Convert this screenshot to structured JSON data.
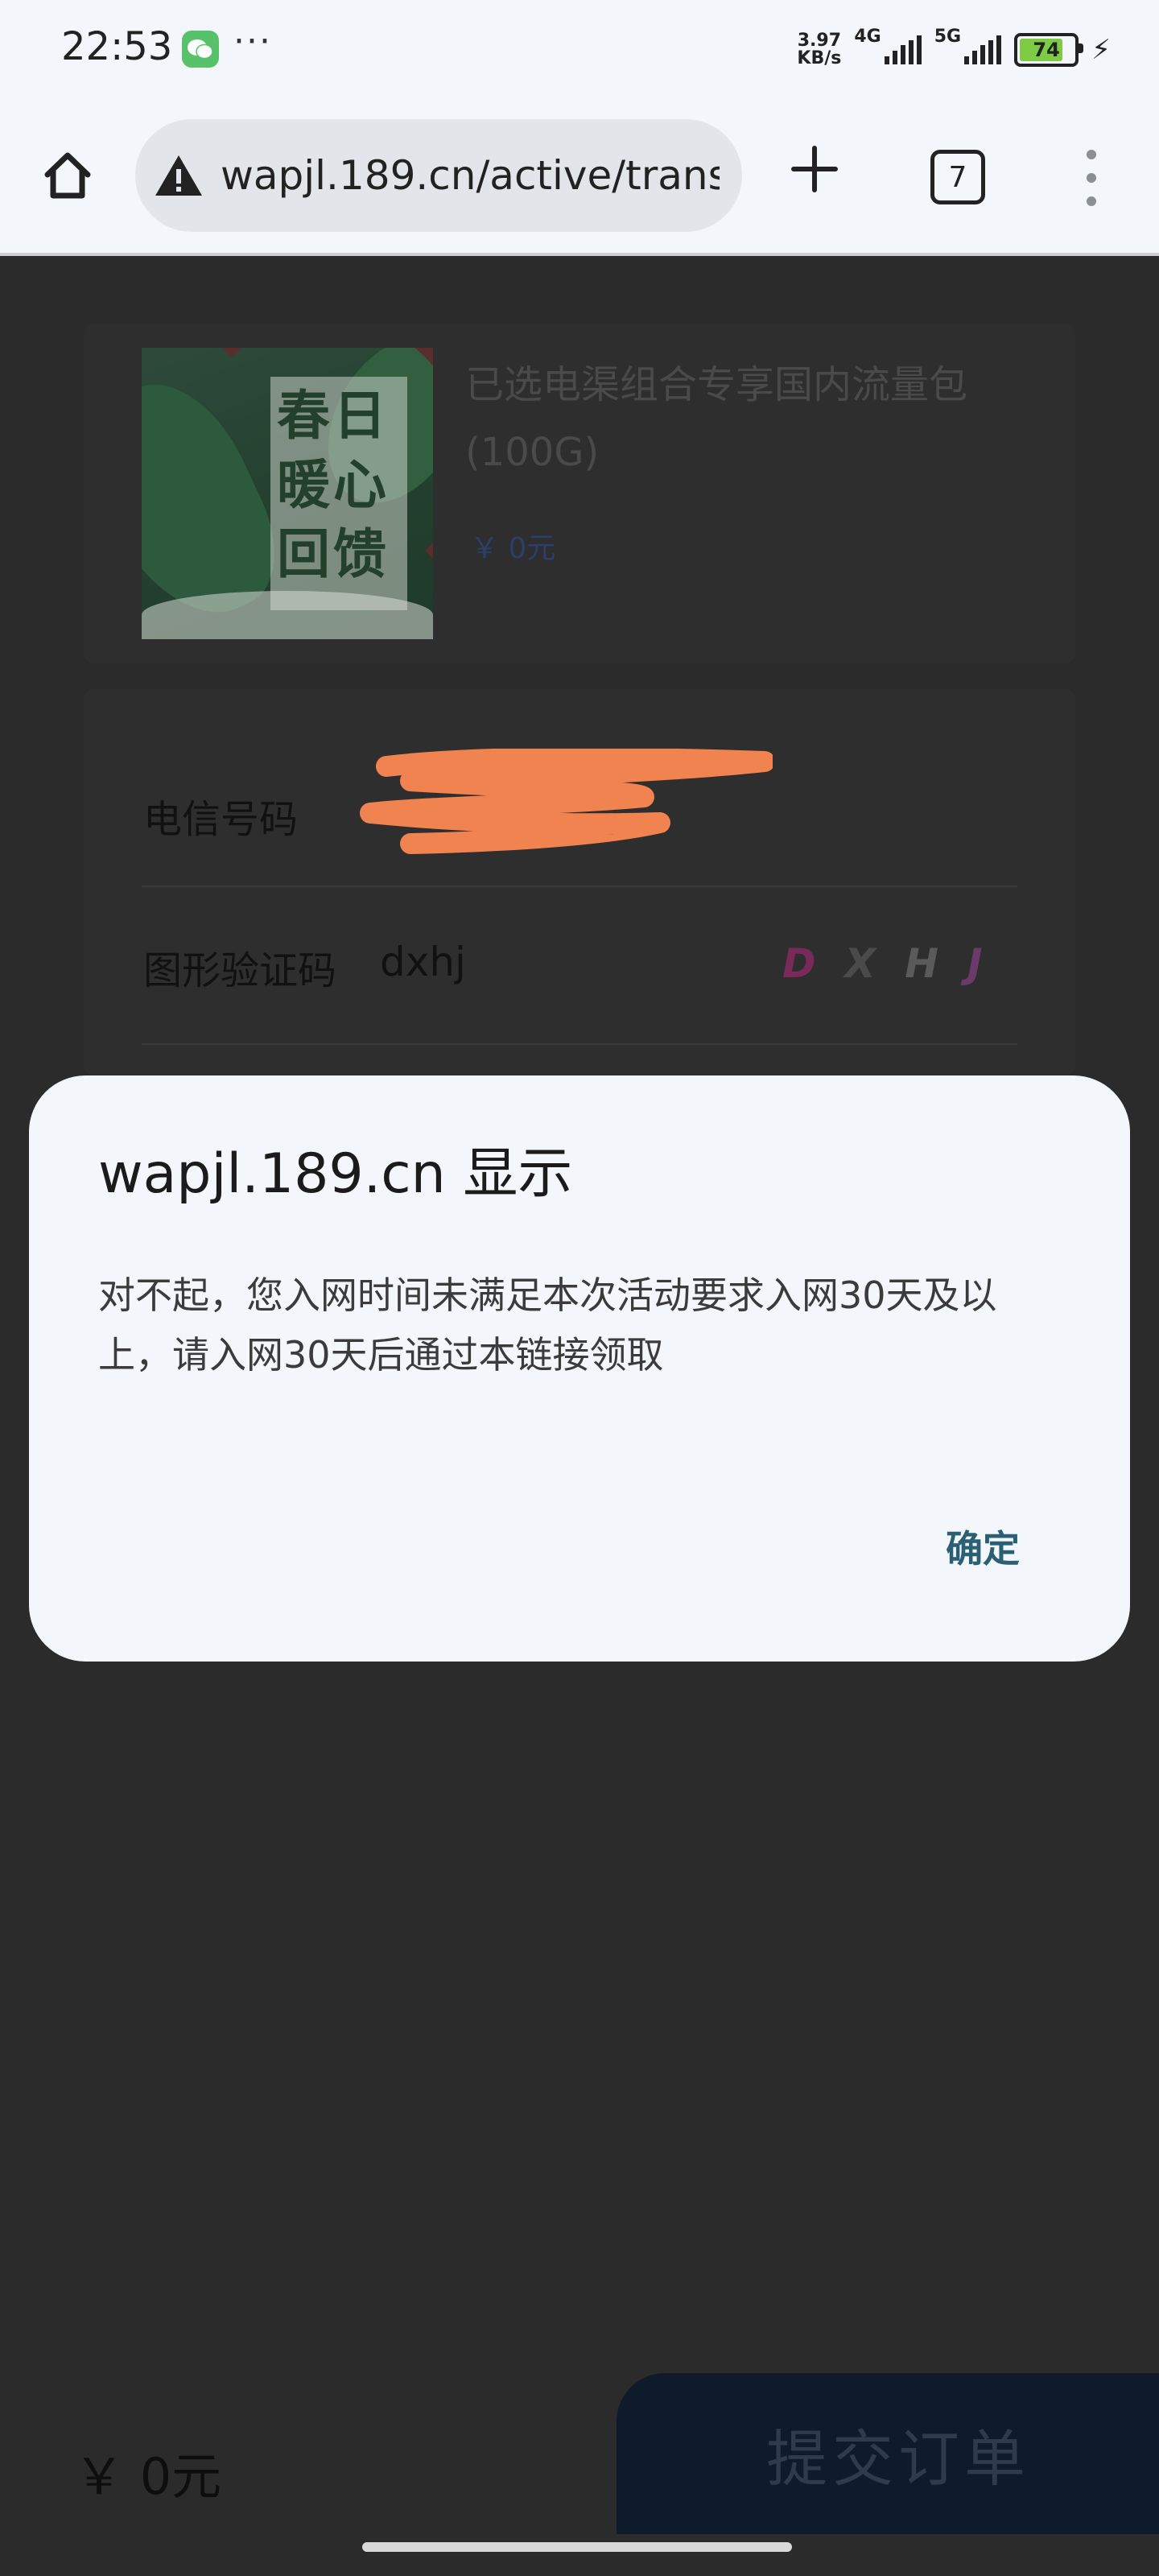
{
  "status_bar": {
    "time": "22:53",
    "notification_more": "···",
    "net_speed_value": "3.97",
    "net_speed_unit": "KB/s",
    "sim1_label": "4G",
    "sim2_label": "5G",
    "battery_level": "74",
    "icons": [
      "wechat-icon",
      "signal-icon",
      "battery-icon",
      "charging-icon"
    ]
  },
  "browser": {
    "url": "wapjl.189.cn/active/trans",
    "tab_count": "7",
    "icons": [
      "home-icon",
      "warning-icon",
      "plus-icon",
      "tabs-icon",
      "more-vert-icon"
    ]
  },
  "product": {
    "title": "已选电渠组合专享国内流量包(100G)",
    "price": "￥ 0元",
    "image_text": [
      "春",
      "日",
      "暖",
      "心",
      "回",
      "馈"
    ]
  },
  "form": {
    "phone_label": "电信号码",
    "captcha_label": "图形验证码",
    "captcha_value": "dxhj",
    "captcha_chars": [
      "D",
      "X",
      "H",
      "J"
    ],
    "captcha_colors": [
      "#7a2a5a",
      "#4a4a4a",
      "#5a5a5a",
      "#6a3a6a"
    ]
  },
  "footer": {
    "total": "￥ 0元",
    "submit_label": "提交订单"
  },
  "dialog": {
    "title": "wapjl.189.cn 显示",
    "message": "对不起，您入网时间未满足本次活动要求入网30天及以上，请入网30天后通过本链接领取",
    "ok_label": "确定"
  },
  "colors": {
    "overlay_background": "#2b2b2b",
    "dialog_background": "#f3f7fb",
    "accent": "#2b5f73",
    "redaction": "#f0834f"
  }
}
